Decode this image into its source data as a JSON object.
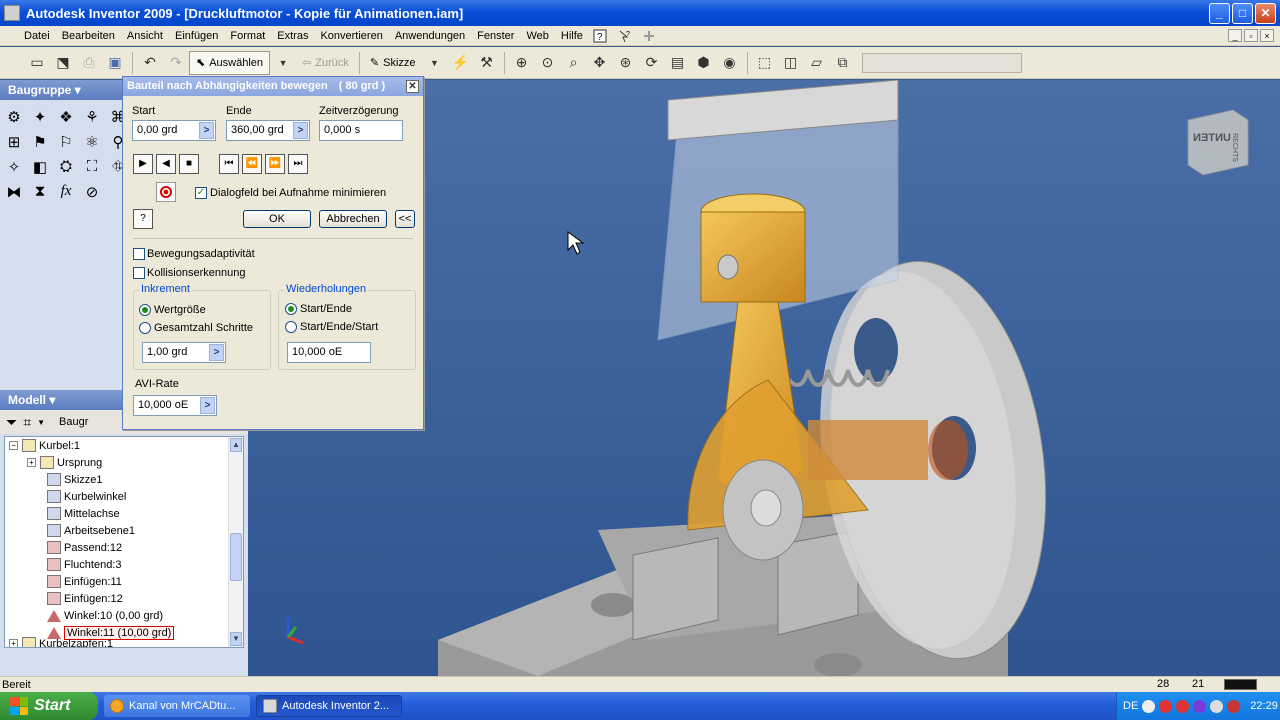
{
  "window": {
    "title": "Autodesk Inventor 2009 - [Druckluftmotor - Kopie für Animationen.iam]",
    "buttons": {
      "minimize": "_",
      "maximize": "□",
      "close": "✕"
    }
  },
  "menu": {
    "items": [
      "Datei",
      "Bearbeiten",
      "Ansicht",
      "Einfügen",
      "Format",
      "Extras",
      "Konvertieren",
      "Anwendungen",
      "Fenster",
      "Web",
      "Hilfe"
    ]
  },
  "toolbar": {
    "select_label": "Auswählen",
    "back_label": "Zurück",
    "sketch_label": "Skizze"
  },
  "left_panel": {
    "header": "Baugruppe ▾",
    "model_header": "Modell ▾",
    "model_toolbar_label": "Baugr"
  },
  "tree": {
    "items": [
      {
        "label": "Kurbel:1",
        "icon": "assembly-icon",
        "indent": 0
      },
      {
        "label": "Ursprung",
        "icon": "folder-icon",
        "indent": 1
      },
      {
        "label": "Skizze1",
        "icon": "sketch-icon",
        "indent": 1
      },
      {
        "label": "Kurbelwinkel",
        "icon": "sketch-icon",
        "indent": 1
      },
      {
        "label": "Mittelachse",
        "icon": "sketch-icon",
        "indent": 1
      },
      {
        "label": "Arbeitsebene1",
        "icon": "plane-icon",
        "indent": 1
      },
      {
        "label": "Passend:12",
        "icon": "mate-constraint-icon",
        "indent": 1
      },
      {
        "label": "Fluchtend:3",
        "icon": "flush-constraint-icon",
        "indent": 1
      },
      {
        "label": "Einfügen:11",
        "icon": "insert-constraint-icon",
        "indent": 1
      },
      {
        "label": "Einfügen:12",
        "icon": "insert-constraint-icon",
        "indent": 1
      },
      {
        "label": "Winkel:10 (0,00 grd)",
        "icon": "angle-constraint-icon",
        "indent": 1
      },
      {
        "label": "Winkel:11 (10,00 grd)",
        "icon": "angle-constraint-icon",
        "indent": 1,
        "highlighted": true
      },
      {
        "label": "Kurbelzapfen:1",
        "icon": "assembly-icon",
        "indent": 0
      }
    ]
  },
  "dialog": {
    "title": "Bauteil nach Abhängigkeiten bewegen",
    "title_value": "( 80 grd )",
    "start_label": "Start",
    "start_value": "0,00 grd",
    "end_label": "Ende",
    "end_value": "360,00 grd",
    "delay_label": "Zeitverzögerung",
    "delay_value": "0,000 s",
    "minimize_label": "Dialogfeld bei Aufnahme minimieren",
    "ok_label": "OK",
    "cancel_label": "Abbrechen",
    "more_label": "<<",
    "adaptivity_label": "Bewegungsadaptivität",
    "collision_label": "Kollisionserkennung",
    "increment_group": "Inkrement",
    "increment_size": "Wertgröße",
    "increment_total": "Gesamtzahl Schritte",
    "increment_value": "1,00 grd",
    "repeat_group": "Wiederholungen",
    "repeat_startend": "Start/Ende",
    "repeat_startendstart": "Start/Ende/Start",
    "repeat_value": "10,000 oE",
    "avi_label": "AVI-Rate",
    "avi_value": "10,000 oE",
    "help_label": "?",
    "minimize_checked": true
  },
  "viewcube": {
    "face_label": "UNTEN",
    "side_label": "RECHTS"
  },
  "status": {
    "text": "Bereit",
    "num1": "28",
    "num2": "21"
  },
  "taskbar": {
    "start_label": "Start",
    "task1": "Kanal von MrCADtu...",
    "task2": "Autodesk Inventor 2...",
    "lang": "DE",
    "clock": "22:29"
  },
  "colors": {
    "viewport_bg": "#3a5f98",
    "part_orange": "#e6a93a",
    "dialog_bg": "#ece9d8"
  }
}
